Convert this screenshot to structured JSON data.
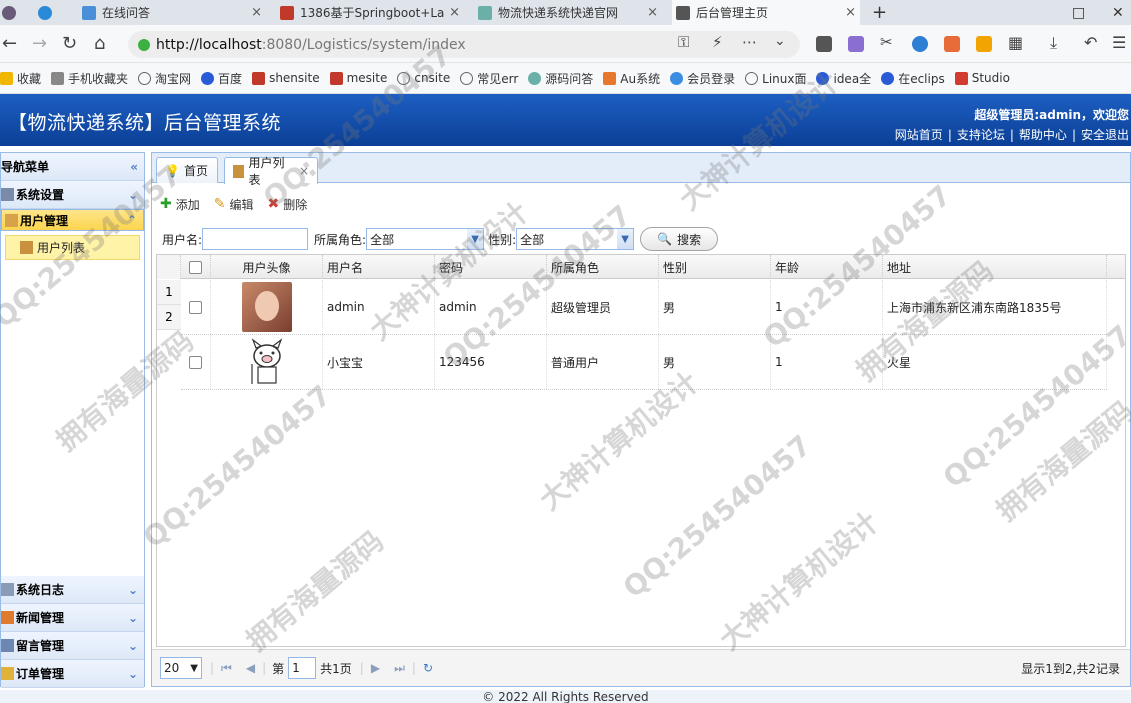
{
  "browser": {
    "tabs": [
      {
        "title": "在线问答",
        "color": "#4a90d9"
      },
      {
        "title": "1386基于Springboot+La",
        "color": "#c0392b"
      },
      {
        "title": "物流快递系统快递官网",
        "color": "#6ab0a9"
      },
      {
        "title": "后台管理主页",
        "color": "#555555"
      }
    ],
    "url_host": "http://localhost",
    "url_rest": ":8080/Logistics/system/index",
    "bookmarks": [
      "收藏",
      "手机收藏夹",
      "淘宝网",
      "百度",
      "shensite",
      "mesite",
      "cnsite",
      "常见err",
      "源码问答",
      "Au系统",
      "会员登录",
      "Linux面",
      "idea全",
      "在eclips",
      "Studio"
    ]
  },
  "header": {
    "title": "【物流快递系统】后台管理系统",
    "admin_line": "超级管理员:admin，欢迎您",
    "links": [
      "网站首页",
      "支持论坛",
      "帮助中心",
      "安全退出"
    ]
  },
  "sidebar": {
    "title": "导航菜单",
    "sections_top": [
      {
        "label": "系统设置",
        "selected": false
      },
      {
        "label": "用户管理",
        "selected": true
      }
    ],
    "active_item": "用户列表",
    "sections_bottom": [
      "系统日志",
      "新闻管理",
      "留言管理",
      "订单管理"
    ]
  },
  "main": {
    "tabs": [
      "首页",
      "用户列表"
    ],
    "toolbar": {
      "add": "添加",
      "edit": "编辑",
      "delete": "删除"
    },
    "search": {
      "username_label": "用户名:",
      "role_label": "所属角色:",
      "role_value": "全部",
      "gender_label": "性别:",
      "gender_value": "全部",
      "button": "搜索"
    },
    "columns": [
      "用户头像",
      "用户名",
      "密码",
      "所属角色",
      "性别",
      "年龄",
      "地址"
    ],
    "rows": [
      {
        "num": "1",
        "username": "admin",
        "password": "admin",
        "role": "超级管理员",
        "gender": "男",
        "age": "1",
        "address": "上海市浦东新区浦东南路1835号"
      },
      {
        "num": "2",
        "username": "小宝宝",
        "password": "123456",
        "role": "普通用户",
        "gender": "男",
        "age": "1",
        "address": "火星"
      }
    ],
    "pager": {
      "page_size": "20",
      "page_prefix": "第",
      "page_value": "1",
      "page_suffix": "共1页",
      "summary": "显示1到2,共2记录"
    }
  },
  "footer": "© 2022 All Rights Reserved",
  "watermark": [
    "QQ:254540457",
    "拥有海量源码",
    "大神计算机设计"
  ]
}
